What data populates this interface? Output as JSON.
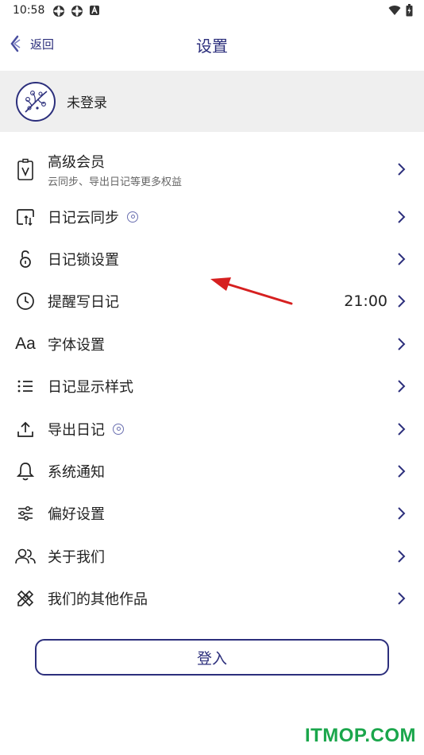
{
  "status_bar": {
    "time": "10:58"
  },
  "header": {
    "back_label": "返回",
    "title": "设置"
  },
  "profile": {
    "name": "未登录"
  },
  "settings": [
    {
      "title": "高级会员",
      "subtitle": "云同步、导出日记等更多权益",
      "icon": "vip-card-icon"
    },
    {
      "title": "日记云同步",
      "icon": "cloud-sync-icon",
      "badge": "coin-badge-icon"
    },
    {
      "title": "日记锁设置",
      "icon": "lock-icon"
    },
    {
      "title": "提醒写日记",
      "icon": "clock-icon",
      "value": "21:00"
    },
    {
      "title": "字体设置",
      "icon": "font-icon",
      "icon_glyph": "Aa"
    },
    {
      "title": "日记显示样式",
      "icon": "list-style-icon"
    },
    {
      "title": "导出日记",
      "icon": "export-icon",
      "badge": "coin-badge-icon"
    },
    {
      "title": "系统通知",
      "icon": "bell-icon"
    },
    {
      "title": "偏好设置",
      "icon": "sliders-icon"
    },
    {
      "title": "关于我们",
      "icon": "users-icon"
    },
    {
      "title": "我们的其他作品",
      "icon": "tools-icon"
    }
  ],
  "login_button": {
    "label": "登入"
  },
  "watermark": {
    "text": "ITMOP.COM"
  },
  "colors": {
    "accent": "#2c2f7c",
    "profile_bg": "#efefef",
    "arrow": "#d62020",
    "watermark": "#1aa64b"
  }
}
